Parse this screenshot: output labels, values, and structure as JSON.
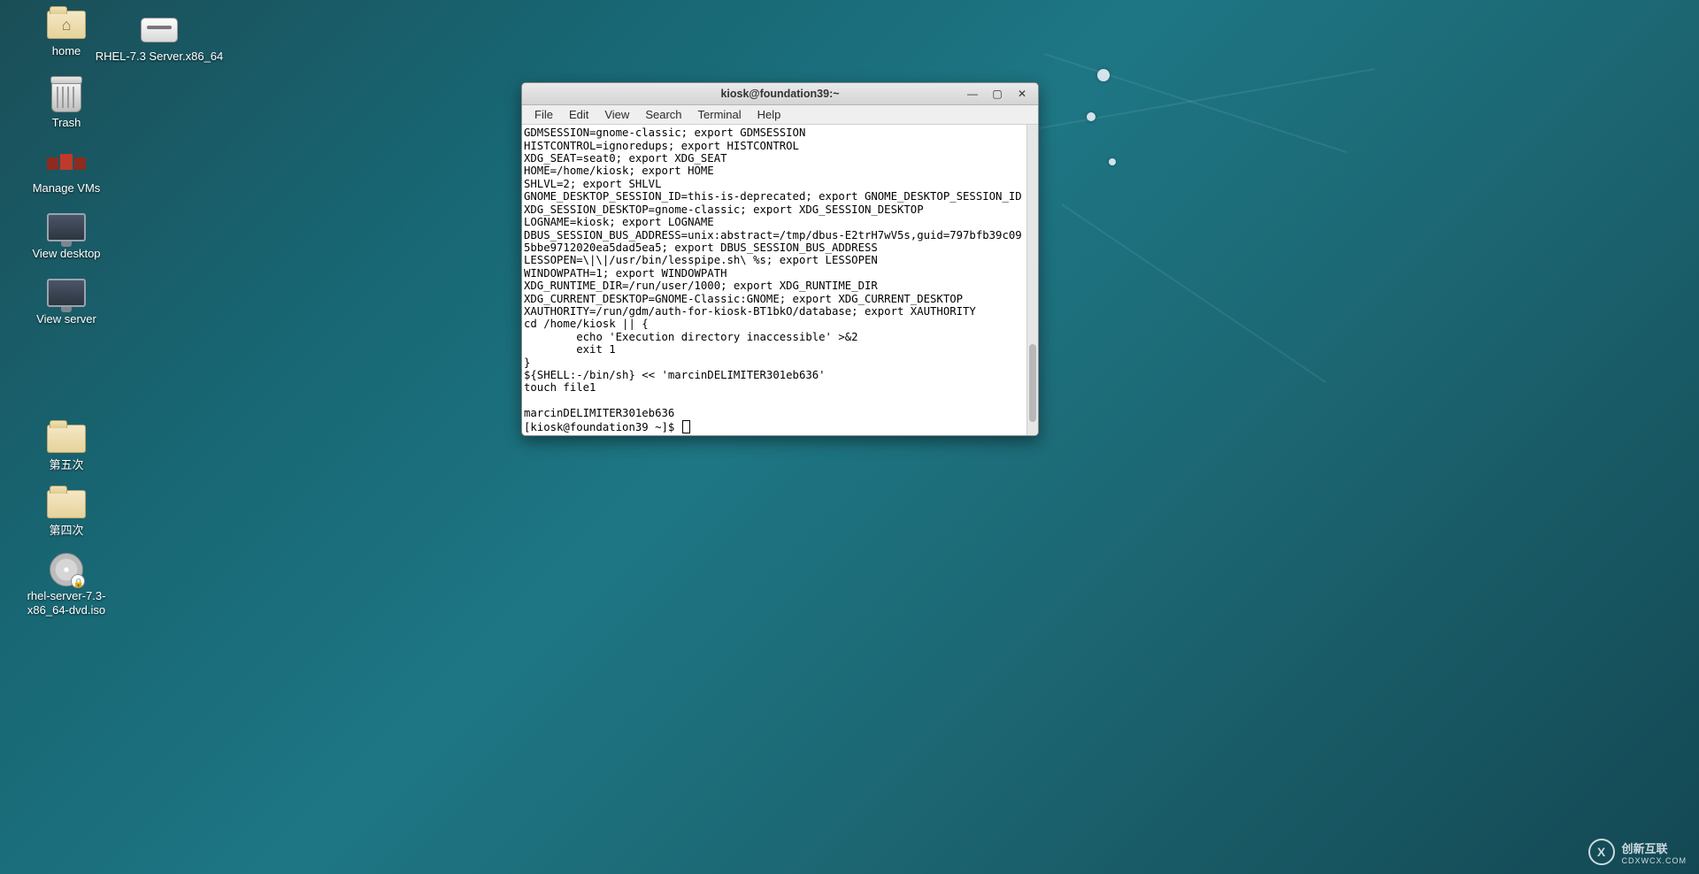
{
  "desktop": {
    "icons": [
      {
        "id": "home",
        "label": "home",
        "type": "folder-home"
      },
      {
        "id": "rhel-disk",
        "label": "RHEL-7.3 Server.x86_64",
        "type": "disk"
      },
      {
        "id": "trash",
        "label": "Trash",
        "type": "trash"
      },
      {
        "id": "manage-vms",
        "label": "Manage VMs",
        "type": "vm"
      },
      {
        "id": "view-desktop",
        "label": "View desktop",
        "type": "monitor"
      },
      {
        "id": "view-server",
        "label": "View server",
        "type": "monitor"
      },
      {
        "id": "folder5",
        "label": "第五次",
        "type": "folder"
      },
      {
        "id": "folder4",
        "label": "第四次",
        "type": "folder"
      },
      {
        "id": "rhel-iso",
        "label": "rhel-server-7.3-x86_64-dvd.iso",
        "type": "iso"
      }
    ]
  },
  "terminal": {
    "title": "kiosk@foundation39:~",
    "window_controls": {
      "minimize": "—",
      "maximize": "▢",
      "close": "✕"
    },
    "menu": [
      "File",
      "Edit",
      "View",
      "Search",
      "Terminal",
      "Help"
    ],
    "lines": [
      "GDMSESSION=gnome-classic; export GDMSESSION",
      "HISTCONTROL=ignoredups; export HISTCONTROL",
      "XDG_SEAT=seat0; export XDG_SEAT",
      "HOME=/home/kiosk; export HOME",
      "SHLVL=2; export SHLVL",
      "GNOME_DESKTOP_SESSION_ID=this-is-deprecated; export GNOME_DESKTOP_SESSION_ID",
      "XDG_SESSION_DESKTOP=gnome-classic; export XDG_SESSION_DESKTOP",
      "LOGNAME=kiosk; export LOGNAME",
      "DBUS_SESSION_BUS_ADDRESS=unix:abstract=/tmp/dbus-E2trH7wV5s,guid=797bfb39c095bbe9712020ea5dad5ea5; export DBUS_SESSION_BUS_ADDRESS",
      "LESSOPEN=\\|\\|/usr/bin/lesspipe.sh\\ %s; export LESSOPEN",
      "WINDOWPATH=1; export WINDOWPATH",
      "XDG_RUNTIME_DIR=/run/user/1000; export XDG_RUNTIME_DIR",
      "XDG_CURRENT_DESKTOP=GNOME-Classic:GNOME; export XDG_CURRENT_DESKTOP",
      "XAUTHORITY=/run/gdm/auth-for-kiosk-BT1bkO/database; export XAUTHORITY",
      "cd /home/kiosk || {",
      "        echo 'Execution directory inaccessible' >&2",
      "        exit 1",
      "}",
      "${SHELL:-/bin/sh} << 'marcinDELIMITER301eb636'",
      "touch file1",
      "",
      "marcinDELIMITER301eb636"
    ],
    "prompt": "[kiosk@foundation39 ~]$ "
  },
  "watermark": {
    "text": "创新互联",
    "sub": "CDXWCX.COM",
    "logo": "X"
  }
}
